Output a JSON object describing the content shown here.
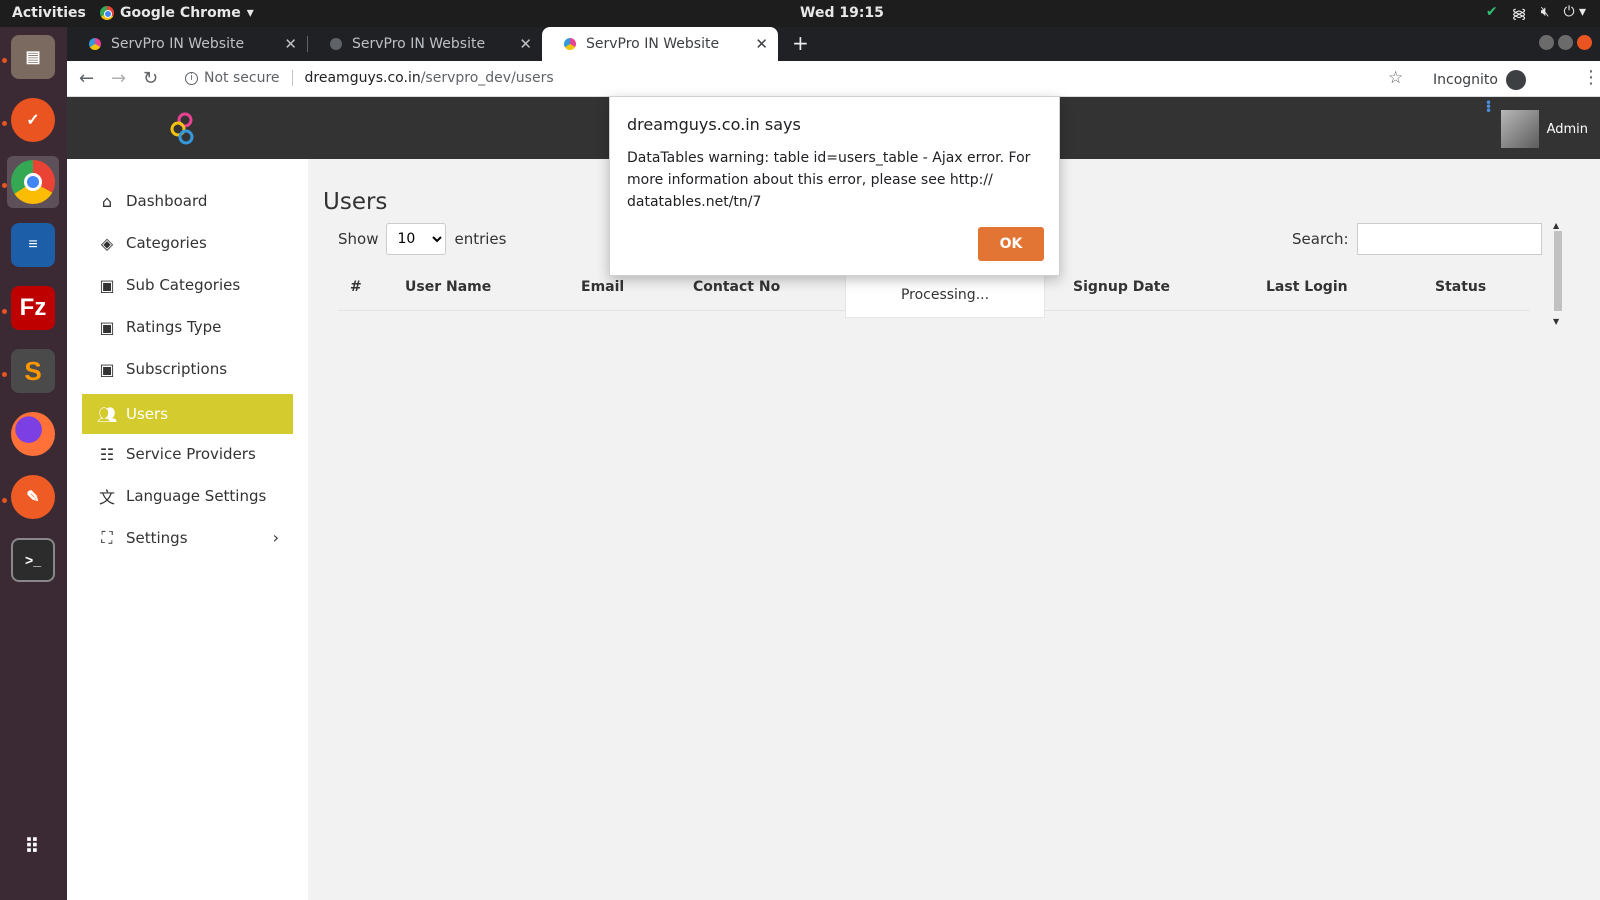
{
  "os": {
    "activities": "Activities",
    "app_name": "Google Chrome",
    "clock": "Wed 19:15"
  },
  "browser": {
    "tabs": [
      {
        "label": "ServPro IN Website"
      },
      {
        "label": "ServPro IN Website"
      },
      {
        "label": "ServPro IN Website"
      }
    ],
    "security_label": "Not secure",
    "url_host": "dreamguys.co.in",
    "url_path": "/servpro_dev/users",
    "incognito_label": "Incognito"
  },
  "header": {
    "admin_label": "Admin"
  },
  "sidebar": {
    "items": [
      {
        "label": "Dashboard",
        "icon": "home-icon"
      },
      {
        "label": "Categories",
        "icon": "layers-icon"
      },
      {
        "label": "Sub Categories",
        "icon": "id-card-icon"
      },
      {
        "label": "Ratings Type",
        "icon": "id-card-icon"
      },
      {
        "label": "Subscriptions",
        "icon": "id-card-icon"
      },
      {
        "label": "Users",
        "icon": "users-icon"
      },
      {
        "label": "Service Providers",
        "icon": "contact-card-icon"
      },
      {
        "label": "Language Settings",
        "icon": "translate-icon"
      },
      {
        "label": "Settings",
        "icon": "settings-frame-icon"
      }
    ]
  },
  "main": {
    "title": "Users",
    "show_label": "Show",
    "entries_value": "10",
    "entries_label": "entries",
    "search_label": "Search:",
    "columns": [
      "#",
      "User Name",
      "Email",
      "Contact No",
      "Signup Date",
      "Last Login",
      "Status"
    ],
    "processing": "Processing..."
  },
  "dialog": {
    "title": "dreamguys.co.in says",
    "message": "DataTables warning: table id=users_table - Ajax error. For more information about this error, please see http:// datatables.net/tn/7",
    "ok_label": "OK"
  },
  "colors": {
    "active_sidebar": "#d4cb2e",
    "ok_button": "#e27434",
    "header_bg": "#333333"
  }
}
